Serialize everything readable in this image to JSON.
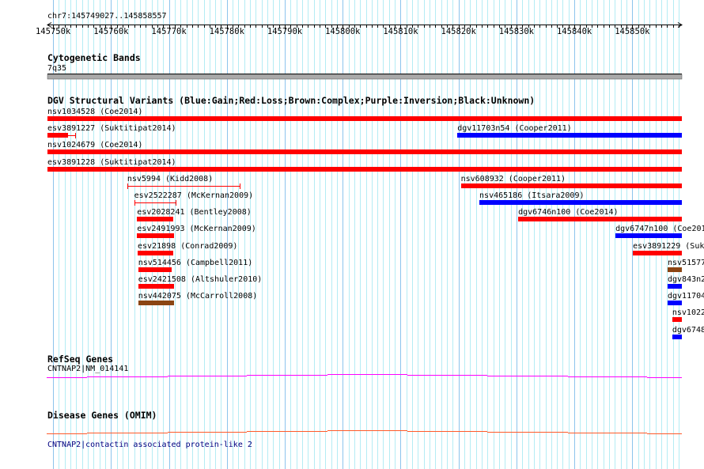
{
  "ruler": {
    "position": "chr7:145749027..145858557",
    "start_kb": 145749.027,
    "end_kb": 145858.557,
    "tick_labels": [
      "145750k",
      "145760k",
      "145770k",
      "145780k",
      "145790k",
      "145800k",
      "145810k",
      "145820k",
      "145830k",
      "145840k",
      "145850k"
    ]
  },
  "cytoband": {
    "title": "Cytogenetic Bands",
    "band": "7q35",
    "color": "#aaaaaa"
  },
  "dgv": {
    "title": "DGV Structural Variants (Blue:Gain;Red:Loss;Brown:Complex;Purple:Inversion;Black:Unknown)",
    "colors": {
      "gain": "#0000ff",
      "loss": "#ff0000",
      "complex": "#8b4513"
    },
    "rows": [
      [
        {
          "label": "nsv1034528 (Coe2014)",
          "start": 145749.0,
          "end": 145858.6,
          "type": "loss"
        }
      ],
      [
        {
          "label": "esv3891227 (Suktitipat2014)",
          "start": 145749.0,
          "end": 145752.6,
          "thin_end": 145753.8,
          "type": "loss"
        },
        {
          "label": "dgv11703n54 (Cooper2011)",
          "start": 145819.8,
          "end": 145858.6,
          "type": "gain"
        }
      ],
      [
        {
          "label": "nsv1024679 (Coe2014)",
          "start": 145749.0,
          "end": 145858.6,
          "type": "loss"
        }
      ],
      [
        {
          "label": "esv3891228 (Suktitipat2014)",
          "start": 145749.0,
          "end": 145858.6,
          "type": "loss"
        }
      ],
      [
        {
          "label": "nsv5994 (Kidd2008)",
          "start": 145762.8,
          "end": 145762.8,
          "thin_end": 145782.2,
          "type": "loss"
        },
        {
          "label": "nsv608932 (Cooper2011)",
          "start": 145820.4,
          "end": 145858.6,
          "type": "loss"
        }
      ],
      [
        {
          "label": "esv2522287 (McKernan2009)",
          "start": 145764.0,
          "end": 145764.0,
          "thin_end": 145771.1,
          "type": "loss"
        },
        {
          "label": "nsv465186 (Itsara2009)",
          "start": 145823.6,
          "end": 145858.6,
          "type": "gain"
        }
      ],
      [
        {
          "label": "esv2028241 (Bentley2008)",
          "start": 145764.5,
          "end": 145770.7,
          "type": "loss"
        },
        {
          "label": "dgv6746n100 (Coe2014)",
          "start": 145830.3,
          "end": 145858.6,
          "type": "loss"
        }
      ],
      [
        {
          "label": "esv2491993 (McKernan2009)",
          "start": 145764.5,
          "end": 145770.9,
          "type": "loss"
        },
        {
          "label": "dgv6747n100 (Coe201",
          "start": 145847.1,
          "end": 145858.6,
          "type": "gain"
        }
      ],
      [
        {
          "label": "esv21898 (Conrad2009)",
          "start": 145764.6,
          "end": 145770.7,
          "type": "loss"
        },
        {
          "label": "esv3891229 (Suk",
          "start": 145850.1,
          "end": 145858.6,
          "type": "loss"
        }
      ],
      [
        {
          "label": "nsv514456 (Campbell2011)",
          "start": 145764.7,
          "end": 145770.5,
          "type": "loss"
        },
        {
          "label": "nsv51577",
          "start": 145856.1,
          "end": 145858.6,
          "type": "complex"
        }
      ],
      [
        {
          "label": "esv2421508 (Altshuler2010)",
          "start": 145764.7,
          "end": 145770.9,
          "type": "loss"
        },
        {
          "label": "dgv843n2",
          "start": 145856.1,
          "end": 145858.6,
          "type": "gain"
        }
      ],
      [
        {
          "label": "nsv442075 (McCarroll2008)",
          "start": 145764.7,
          "end": 145770.9,
          "type": "complex"
        },
        {
          "label": "dgv11704",
          "start": 145856.1,
          "end": 145858.6,
          "type": "gain"
        }
      ],
      [
        {
          "label": "nsv1022",
          "start": 145856.9,
          "end": 145858.6,
          "type": "loss"
        }
      ],
      [
        {
          "label": "dgv6748",
          "start": 145856.9,
          "end": 145858.6,
          "type": "gain"
        }
      ]
    ]
  },
  "refseq": {
    "title": "RefSeq Genes",
    "gene": "CNTNAP2|NM_014141",
    "color": "#ff00ff"
  },
  "omim": {
    "title": "Disease Genes (OMIM)",
    "gene": "CNTNAP2|contactin associated protein-like 2",
    "color": "#ff5a2a",
    "text_color": "#000080"
  }
}
